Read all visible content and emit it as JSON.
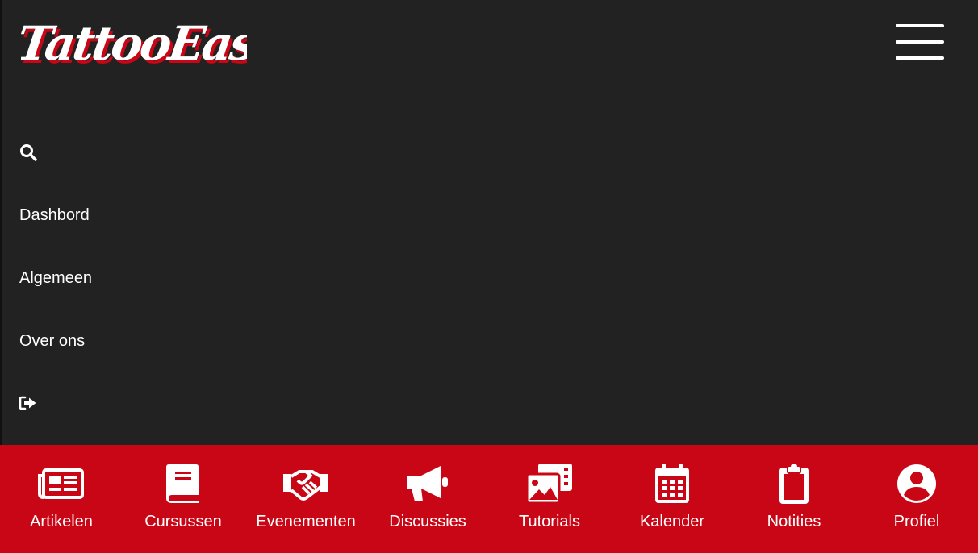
{
  "app": {
    "logo_text": "TattooEase",
    "brand_red": "#c90615",
    "bg": "#222222"
  },
  "header": {
    "menu_icon": "hamburger-menu-icon"
  },
  "sidebar": {
    "search_icon": "search-icon",
    "items": [
      {
        "label": "Dashbord"
      },
      {
        "label": "Algemeen"
      },
      {
        "label": "Over ons"
      }
    ],
    "logout_icon": "logout-icon"
  },
  "bottom_nav": {
    "tabs": [
      {
        "label": "Artikelen",
        "icon": "newspaper-icon"
      },
      {
        "label": "Cursussen",
        "icon": "book-icon"
      },
      {
        "label": "Evenementen",
        "icon": "handshake-icon"
      },
      {
        "label": "Discussies",
        "icon": "megaphone-icon"
      },
      {
        "label": "Tutorials",
        "icon": "photo-video-icon"
      },
      {
        "label": "Kalender",
        "icon": "calendar-icon"
      },
      {
        "label": "Notities",
        "icon": "clipboard-icon"
      },
      {
        "label": "Profiel",
        "icon": "user-circle-icon"
      }
    ]
  }
}
